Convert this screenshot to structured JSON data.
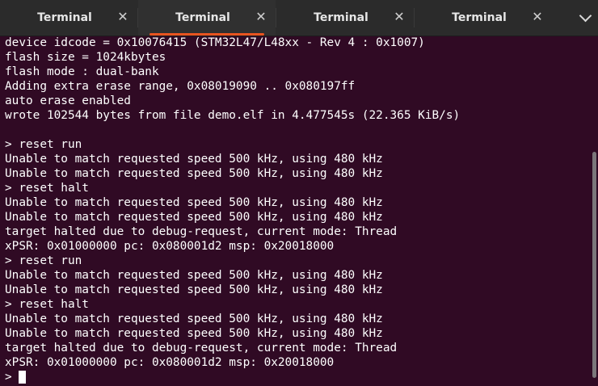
{
  "tabs": [
    {
      "label": "Terminal",
      "close": "✕",
      "active": false
    },
    {
      "label": "Terminal",
      "close": "✕",
      "active": true
    },
    {
      "label": "Terminal",
      "close": "✕",
      "active": false
    },
    {
      "label": "Terminal",
      "close": "✕",
      "active": false
    }
  ],
  "terminal": {
    "lines": [
      "device idcode = 0x10076415 (STM32L47/L48xx - Rev 4 : 0x1007)",
      "flash size = 1024kbytes",
      "flash mode : dual-bank",
      "Adding extra erase range, 0x08019090 .. 0x080197ff",
      "auto erase enabled",
      "wrote 102544 bytes from file demo.elf in 4.477545s (22.365 KiB/s)",
      "",
      "> reset run",
      "Unable to match requested speed 500 kHz, using 480 kHz",
      "Unable to match requested speed 500 kHz, using 480 kHz",
      "> reset halt",
      "Unable to match requested speed 500 kHz, using 480 kHz",
      "Unable to match requested speed 500 kHz, using 480 kHz",
      "target halted due to debug-request, current mode: Thread",
      "xPSR: 0x01000000 pc: 0x080001d2 msp: 0x20018000",
      "> reset run",
      "Unable to match requested speed 500 kHz, using 480 kHz",
      "Unable to match requested speed 500 kHz, using 480 kHz",
      "> reset halt",
      "Unable to match requested speed 500 kHz, using 480 kHz",
      "Unable to match requested speed 500 kHz, using 480 kHz",
      "target halted due to debug-request, current mode: Thread",
      "xPSR: 0x01000000 pc: 0x080001d2 msp: 0x20018000"
    ],
    "prompt": ">"
  },
  "colors": {
    "background": "#300a24",
    "tabbar": "#2b2b2b",
    "accent": "#e95420",
    "text": "#ffffff"
  },
  "icons": {
    "tab_close": "close-icon",
    "tab_menu": "chevron-down-icon"
  }
}
